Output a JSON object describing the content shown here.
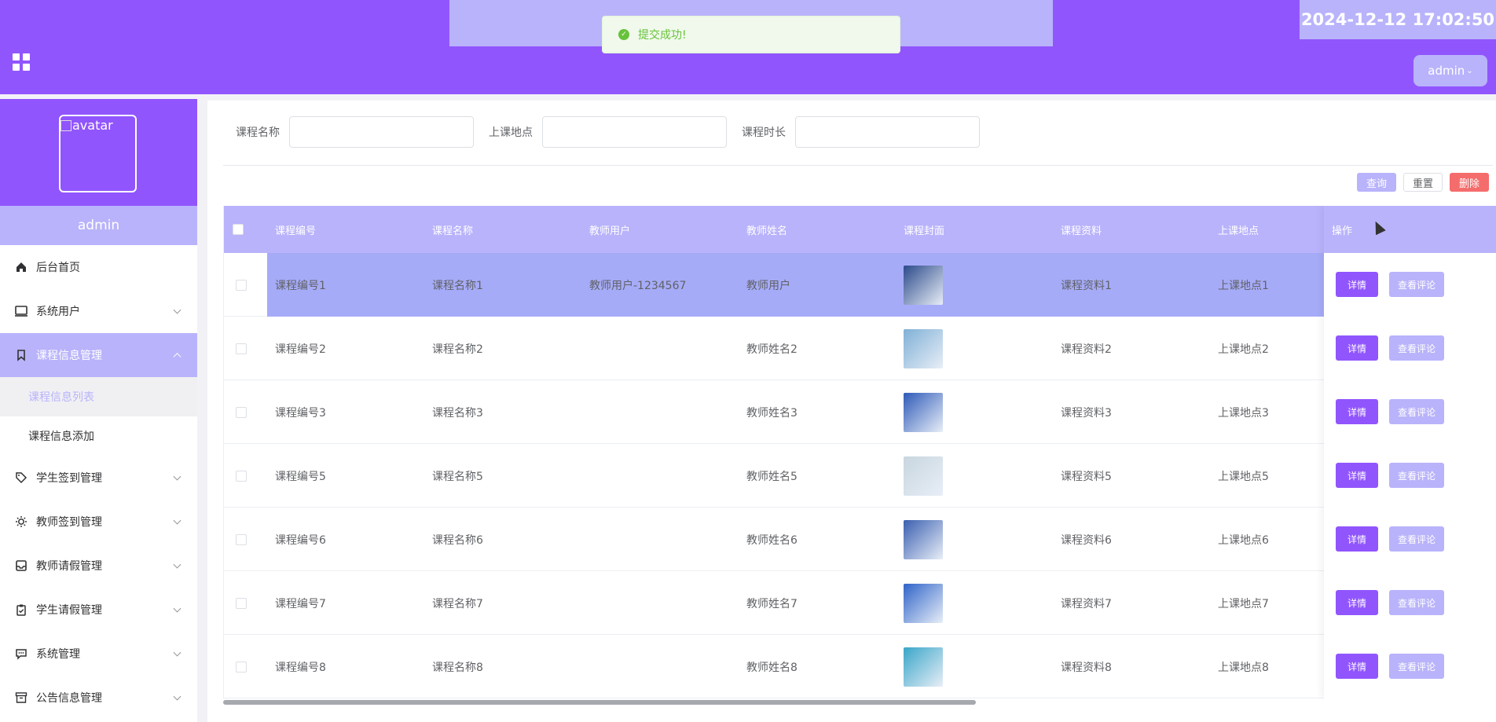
{
  "header": {
    "toast": "提交成功!",
    "datetime": "2024-12-12 17:02:50",
    "user_menu": "admin"
  },
  "sidebar": {
    "avatar_alt": "avatar",
    "username": "admin",
    "items": [
      {
        "label": "后台首页",
        "icon": "home-icon"
      },
      {
        "label": "系统用户",
        "icon": "monitor-icon"
      },
      {
        "label": "课程信息管理",
        "icon": "bookmark-icon",
        "open": true,
        "children": [
          "课程信息列表",
          "课程信息添加"
        ]
      },
      {
        "label": "学生签到管理",
        "icon": "tag-icon"
      },
      {
        "label": "教师签到管理",
        "icon": "sun-icon"
      },
      {
        "label": "教师请假管理",
        "icon": "inbox-icon"
      },
      {
        "label": "学生请假管理",
        "icon": "clipboard-check-icon"
      },
      {
        "label": "系统管理",
        "icon": "chat-icon"
      },
      {
        "label": "公告信息管理",
        "icon": "archive-icon"
      }
    ],
    "active_child": "课程信息列表"
  },
  "search": {
    "field1_label": "课程名称",
    "field2_label": "上课地点",
    "field3_label": "课程时长",
    "query_btn": "查询",
    "reset_btn": "重置",
    "delete_btn": "删除"
  },
  "table": {
    "headers": [
      "课程编号",
      "课程名称",
      "教师用户",
      "教师姓名",
      "课程封面",
      "课程资料",
      "上课地点",
      "操作"
    ],
    "rows": [
      [
        "课程编号1",
        "课程名称1",
        "教师用户-1234567",
        "教师用户",
        "课程资料1",
        "上课地点1"
      ],
      [
        "课程编号2",
        "课程名称2",
        "",
        "教师姓名2",
        "课程资料2",
        "上课地点2"
      ],
      [
        "课程编号3",
        "课程名称3",
        "",
        "教师姓名3",
        "课程资料3",
        "上课地点3"
      ],
      [
        "课程编号5",
        "课程名称5",
        "",
        "教师姓名5",
        "课程资料5",
        "上课地点5"
      ],
      [
        "课程编号6",
        "课程名称6",
        "",
        "教师姓名6",
        "课程资料6",
        "上课地点6"
      ],
      [
        "课程编号7",
        "课程名称7",
        "",
        "教师姓名7",
        "课程资料7",
        "上课地点7"
      ],
      [
        "课程编号8",
        "课程名称8",
        "",
        "教师姓名8",
        "课程资料8",
        "上课地点8"
      ]
    ],
    "cover_colors": [
      "#2b4a8a",
      "#7fb0d6",
      "#2e5ab8",
      "#c8d6df",
      "#3a5fb0",
      "#2f64c9",
      "#39a6c9"
    ],
    "detail_btn": "详情",
    "review_btn": "查看评论"
  }
}
